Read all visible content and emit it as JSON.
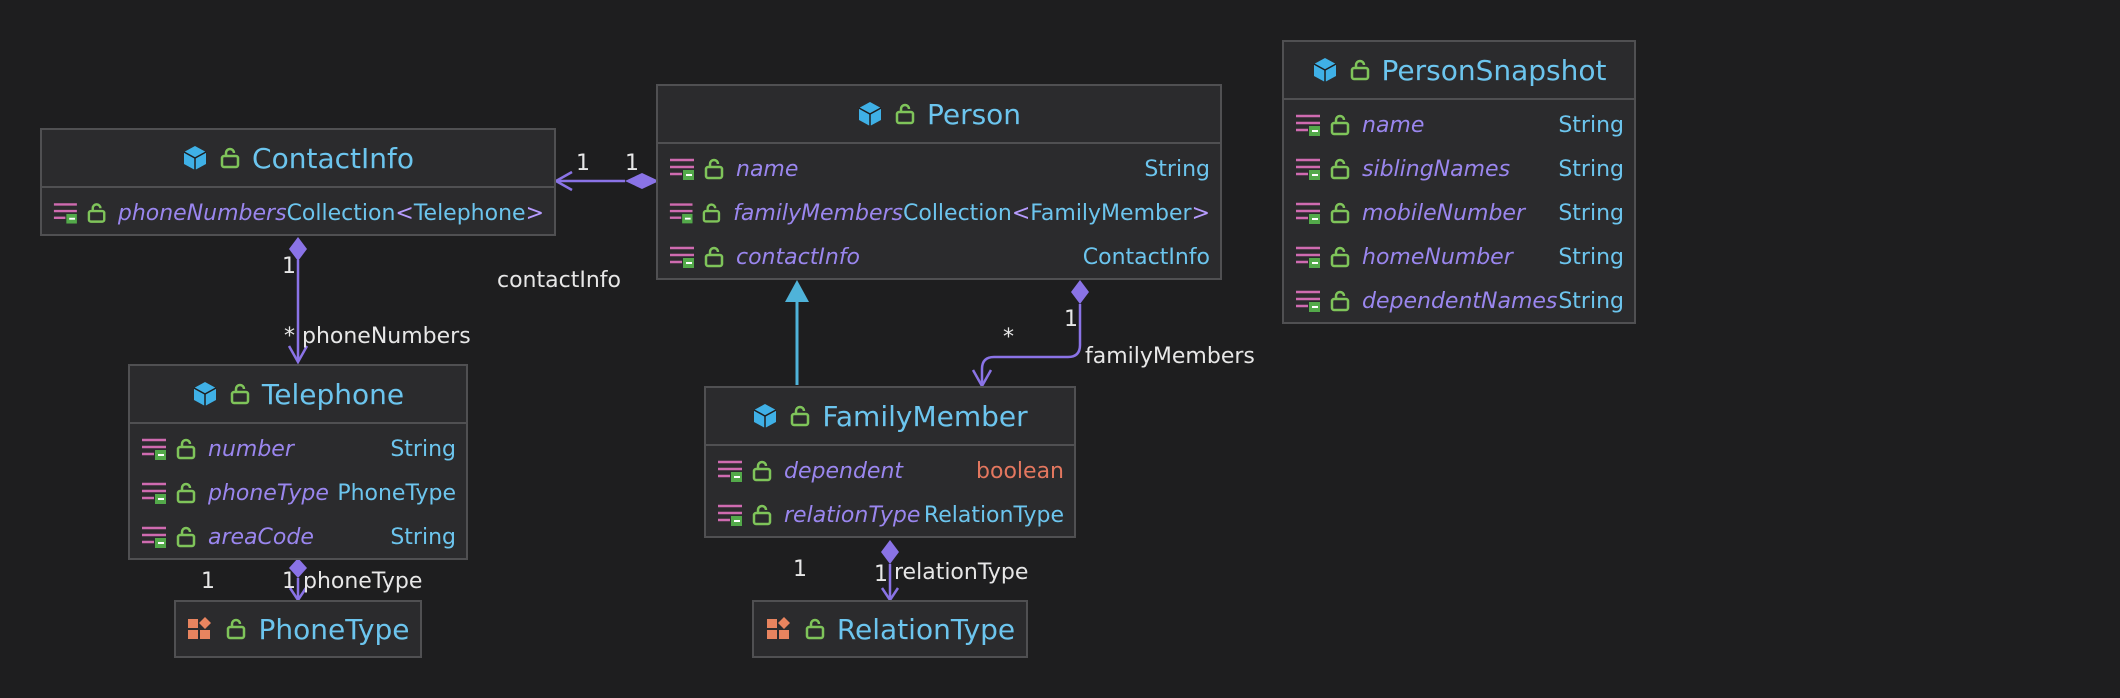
{
  "colors": {
    "background": "#1e1e1f",
    "box": "#2b2b2d",
    "border": "#505052",
    "title": "#6cc5ee",
    "field": "#9a86ee",
    "type": "#6cc5ee",
    "primitive": "#e3775f",
    "edge": "#8a73e6",
    "inheritance": "#4fb3d9"
  },
  "classes": {
    "contactinfo": {
      "name": "ContactInfo",
      "icon": "class-icon",
      "fields": [
        {
          "name": "phoneNumbers",
          "type": "Collection",
          "generic": "Telephone"
        }
      ]
    },
    "person": {
      "name": "Person",
      "icon": "class-icon",
      "fields": [
        {
          "name": "name",
          "type": "String"
        },
        {
          "name": "familyMembers",
          "type": "Collection",
          "generic": "FamilyMember"
        },
        {
          "name": "contactInfo",
          "type": "ContactInfo"
        }
      ]
    },
    "personsnapshot": {
      "name": "PersonSnapshot",
      "icon": "class-icon",
      "fields": [
        {
          "name": "name",
          "type": "String"
        },
        {
          "name": "siblingNames",
          "type": "String"
        },
        {
          "name": "mobileNumber",
          "type": "String"
        },
        {
          "name": "homeNumber",
          "type": "String"
        },
        {
          "name": "dependentNames",
          "type": "String"
        }
      ]
    },
    "telephone": {
      "name": "Telephone",
      "icon": "class-icon",
      "fields": [
        {
          "name": "number",
          "type": "String"
        },
        {
          "name": "phoneType",
          "type": "PhoneType"
        },
        {
          "name": "areaCode",
          "type": "String"
        }
      ]
    },
    "familymember": {
      "name": "FamilyMember",
      "icon": "class-icon",
      "fields": [
        {
          "name": "dependent",
          "type": "boolean"
        },
        {
          "name": "relationType",
          "type": "RelationType"
        }
      ]
    },
    "phonetype": {
      "name": "PhoneType",
      "icon": "enum-icon"
    },
    "relationtype": {
      "name": "RelationType",
      "icon": "enum-icon"
    }
  },
  "edges": {
    "contact": {
      "label": "contactInfo",
      "source_mult": "1",
      "target_mult": "1"
    },
    "phones": {
      "label": "phoneNumbers",
      "source_mult": "1",
      "target_mult": "*"
    },
    "family": {
      "label": "familyMembers",
      "source_mult": "1",
      "target_mult": "*"
    },
    "phonetype": {
      "label": "phoneType",
      "source_mult": "1",
      "target_mult": "1"
    },
    "relationtype": {
      "label": "relationType",
      "source_mult": "1",
      "target_mult": "1"
    }
  }
}
